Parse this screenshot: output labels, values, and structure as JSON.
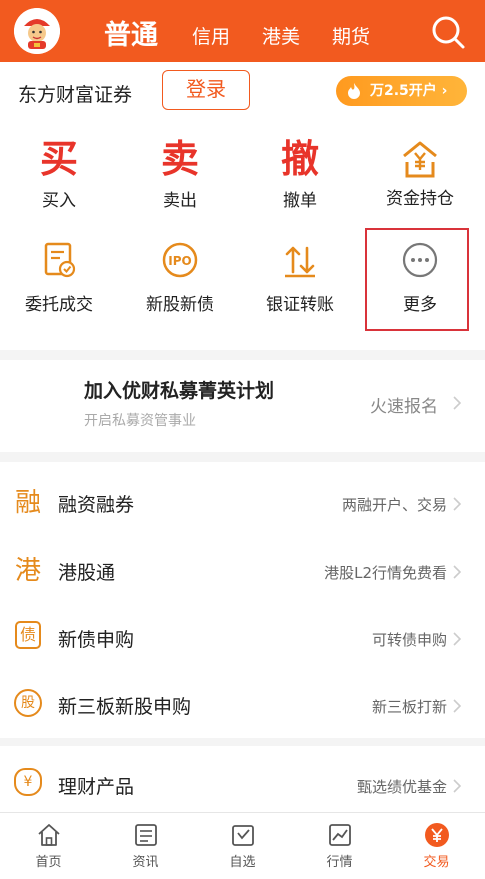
{
  "header": {
    "tabs": [
      {
        "label": "普通",
        "active": true
      },
      {
        "label": "信用",
        "active": false
      },
      {
        "label": "港美",
        "active": false
      },
      {
        "label": "期货",
        "active": false
      }
    ],
    "icons": [
      "avatar-mascot",
      "search-icon"
    ]
  },
  "broker": {
    "name": "东方财富证券",
    "login_label": "登录",
    "open_badge": "万2.5开户 ›"
  },
  "grid": [
    {
      "glyph": "买",
      "label": "买入"
    },
    {
      "glyph": "卖",
      "label": "卖出"
    },
    {
      "glyph": "撤",
      "label": "撤单"
    },
    {
      "icon": "funds-position-icon",
      "label": "资金持仓"
    },
    {
      "icon": "entrust-deal-icon",
      "label": "委托成交"
    },
    {
      "icon": "ipo-icon",
      "icon_text": "IPO",
      "label": "新股新债"
    },
    {
      "icon": "bank-transfer-icon",
      "label": "银证转账"
    },
    {
      "icon": "more-icon",
      "label": "更多"
    }
  ],
  "promo": {
    "title": "加入优财私募菁英计划",
    "subtitle": "开启私募资管事业",
    "action": "火速报名"
  },
  "rows": [
    {
      "icon_glyph": "融",
      "title": "融资融券",
      "right": "两融开户、交易"
    },
    {
      "icon_glyph": "港",
      "title": "港股通",
      "right": "港股L2行情免费看"
    },
    {
      "icon_glyph": "债",
      "title": "新债申购",
      "right": "可转债申购"
    },
    {
      "icon_glyph": "股",
      "title": "新三板新股申购",
      "right": "新三板打新"
    },
    {
      "icon_glyph": "¥",
      "title": "理财产品",
      "right": "甄选绩优基金"
    }
  ],
  "bottom_nav": [
    {
      "label": "首页",
      "icon": "home-icon",
      "active": false
    },
    {
      "label": "资讯",
      "icon": "news-icon",
      "active": false
    },
    {
      "label": "自选",
      "icon": "watchlist-icon",
      "active": false
    },
    {
      "label": "行情",
      "icon": "market-icon",
      "active": false
    },
    {
      "label": "交易",
      "icon": "trade-yen-icon",
      "active": true
    }
  ],
  "colors": {
    "brand_orange": "#f25a1f",
    "action_red": "#e8342a",
    "icon_orange": "#e58a1c",
    "highlight_red": "#d9333a"
  }
}
